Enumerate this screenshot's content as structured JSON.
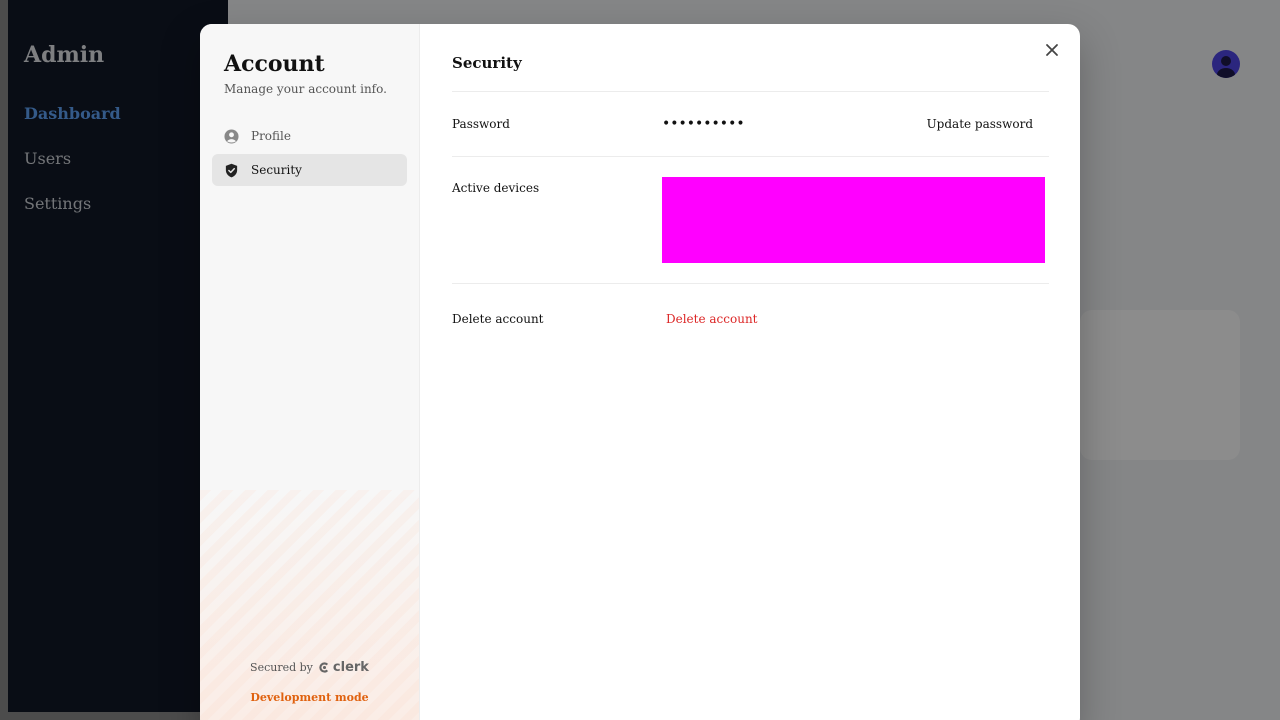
{
  "app": {
    "brand": "Admin",
    "nav": [
      {
        "label": "Dashboard"
      },
      {
        "label": "Users"
      },
      {
        "label": "Settings"
      }
    ]
  },
  "modal": {
    "nav": {
      "title": "Account",
      "subtitle": "Manage your account info.",
      "items": [
        {
          "label": "Profile",
          "icon": "user-circle-icon",
          "active": false
        },
        {
          "label": "Security",
          "icon": "shield-check-icon",
          "active": true
        }
      ],
      "footer": {
        "secured_by": "Secured by",
        "brand": "clerk",
        "dev_mode": "Development mode"
      }
    },
    "content": {
      "section_title": "Security",
      "password": {
        "label": "Password",
        "value": "••••••••••",
        "action": "Update password"
      },
      "devices": {
        "label": "Active devices",
        "placeholder_color": "#ff00ff"
      },
      "delete": {
        "label": "Delete account",
        "action": "Delete account"
      }
    }
  },
  "colors": {
    "danger": "#dc2626",
    "dev_mode": "#e0620f",
    "active_nav": "#60a5fa"
  }
}
